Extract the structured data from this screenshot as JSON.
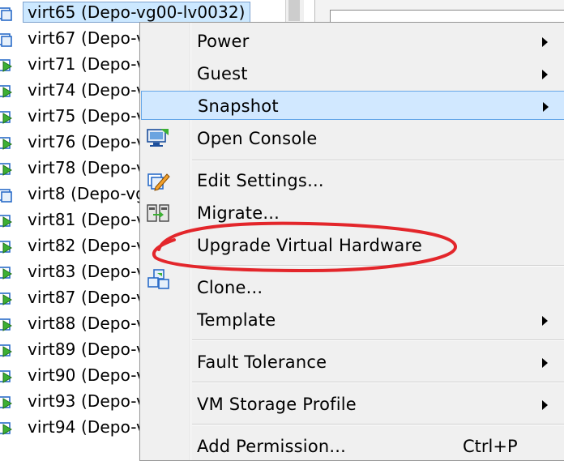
{
  "tree": {
    "items": [
      {
        "label": "virt65 (Depo-vg00-lv0032)",
        "selected": true
      },
      {
        "label": "virt67 (Depo-v"
      },
      {
        "label": "virt71 (Depo-v"
      },
      {
        "label": "virt74 (Depo-v"
      },
      {
        "label": "virt75 (Depo-v"
      },
      {
        "label": "virt76 (Depo-v"
      },
      {
        "label": "virt78 (Depo-v"
      },
      {
        "label": "virt8 (Depo-vg"
      },
      {
        "label": "virt81 (Depo-v"
      },
      {
        "label": "virt82 (Depo-v"
      },
      {
        "label": "virt83 (Depo-v"
      },
      {
        "label": "virt87 (Depo-v"
      },
      {
        "label": "virt88 (Depo-v"
      },
      {
        "label": "virt89 (Depo-v"
      },
      {
        "label": "virt90 (Depo-v"
      },
      {
        "label": "virt93 (Depo-v"
      },
      {
        "label": "virt94 (Depo-v"
      }
    ]
  },
  "context_menu": {
    "items": [
      {
        "label": "Power",
        "submenu": true
      },
      {
        "label": "Guest",
        "submenu": true
      },
      {
        "label": "Snapshot",
        "submenu": true,
        "highlighted": true
      },
      {
        "label": "Open Console",
        "icon": "console-icon"
      },
      {
        "label": "Edit Settings...",
        "icon": "edit-settings-icon"
      },
      {
        "label": "Migrate...",
        "icon": "migrate-icon"
      },
      {
        "label": "Upgrade Virtual Hardware",
        "annotated": true
      },
      {
        "label": "Clone...",
        "icon": "clone-icon"
      },
      {
        "label": "Template",
        "submenu": true
      },
      {
        "label": "Fault Tolerance",
        "submenu": true
      },
      {
        "label": "VM Storage Profile",
        "submenu": true
      },
      {
        "label": "Add Permission...",
        "shortcut": "Ctrl+P"
      }
    ]
  },
  "colors": {
    "highlight_fill": "#d1e8ff",
    "highlight_border": "#66a7e8",
    "annotation_red": "#e3262b",
    "vm_icon_green": "#3cb034"
  }
}
